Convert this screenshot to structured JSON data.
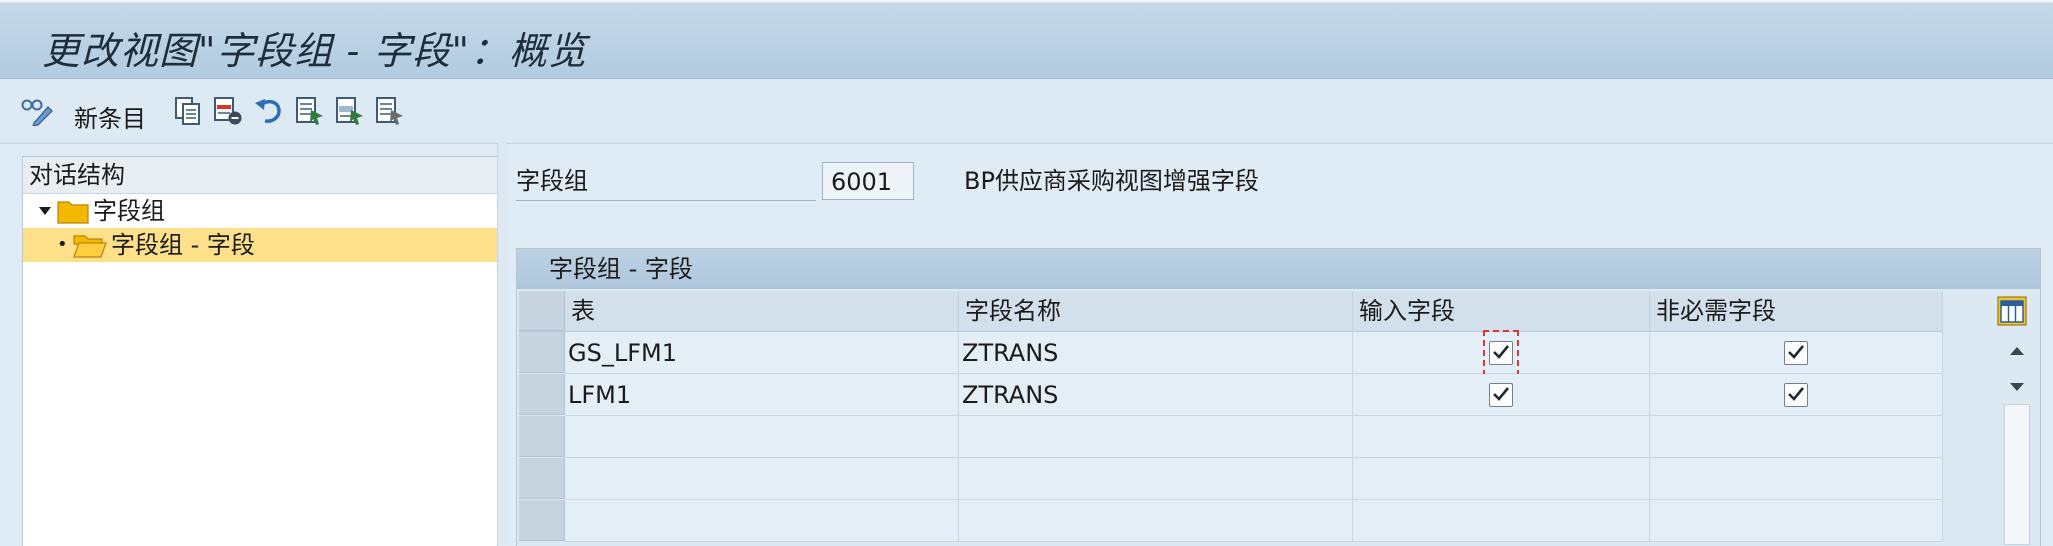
{
  "window": {
    "title": "更改视图\"字段组 - 字段\"：概览"
  },
  "toolbar": {
    "buttons": [
      {
        "icon": "display-change-icon"
      },
      {
        "label": "新条目"
      },
      {
        "icon": "copy-as-icon"
      },
      {
        "icon": "delete-icon"
      },
      {
        "icon": "undo-change-icon"
      },
      {
        "icon": "select-all-icon"
      },
      {
        "icon": "select-block-icon"
      },
      {
        "icon": "deselect-all-icon"
      }
    ]
  },
  "dialog_structure": {
    "header": "对话结构",
    "items": [
      {
        "label": "字段组",
        "expanded": true
      },
      {
        "label": "字段组 - 字段",
        "selected": true
      }
    ]
  },
  "field_group": {
    "label": "字段组",
    "value": "6001",
    "description": "BP供应商采购视图增强字段"
  },
  "table": {
    "title": "字段组 - 字段",
    "columns": [
      "表",
      "字段名称",
      "输入字段",
      "非必需字段"
    ],
    "rows": [
      {
        "table": "GS_LFM1",
        "field": "ZTRANS",
        "input": true,
        "optional": true
      },
      {
        "table": "LFM1",
        "field": "ZTRANS",
        "input": true,
        "optional": true
      },
      {
        "table": "",
        "field": "",
        "input": null,
        "optional": null
      },
      {
        "table": "",
        "field": "",
        "input": null,
        "optional": null
      },
      {
        "table": "",
        "field": "",
        "input": null,
        "optional": null
      }
    ]
  },
  "colors": {
    "title_bar": "#b3cbe0",
    "selected_tree_row": "#ffe08a",
    "focus_outline": "#d83a2e",
    "folder": "#f5b800"
  }
}
